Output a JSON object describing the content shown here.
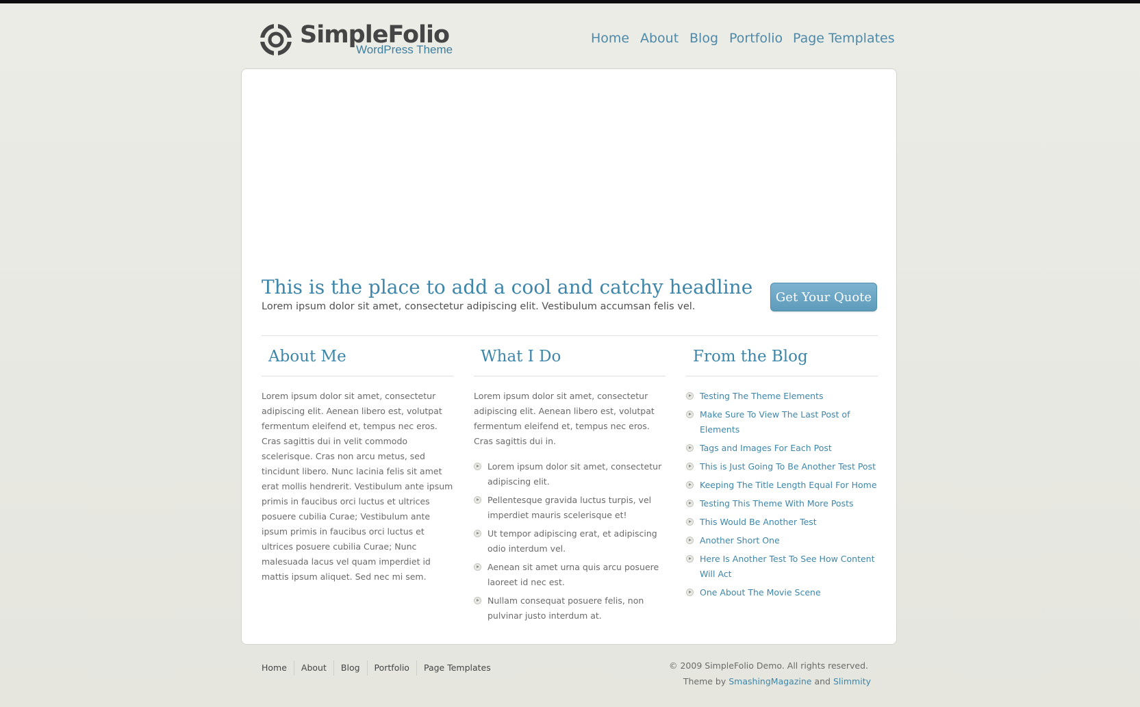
{
  "header": {
    "logo_title": "SimpleFolio",
    "logo_subtitle": "WordPress Theme",
    "nav": [
      "Home",
      "About",
      "Blog",
      "Portfolio",
      "Page Templates"
    ]
  },
  "hero": {
    "headline": "This is the place to add a cool and catchy headline",
    "subline": "Lorem ipsum dolor sit amet, consectetur adipiscing elit. Vestibulum accumsan felis vel.",
    "button_label": "Get Your Quote"
  },
  "about": {
    "title": "About Me",
    "text": "Lorem ipsum dolor sit amet, consectetur adipiscing elit. Aenean libero est, volutpat fermentum eleifend et, tempus nec eros. Cras sagittis dui in velit commodo scelerisque. Cras non arcu metus, sed tincidunt libero. Nunc lacinia felis sit amet erat mollis hendrerit. Vestibulum ante ipsum primis in faucibus orci luctus et ultrices posuere cubilia Curae; Vestibulum ante ipsum primis in faucibus orci luctus et ultrices posuere cubilia Curae; Nunc malesuada lacus vel quam imperdiet id mattis ipsum aliquet. Sed nec mi sem."
  },
  "whatido": {
    "title": "What I Do",
    "text": "Lorem ipsum dolor sit amet, consectetur adipiscing elit. Aenean libero est, volutpat fermentum eleifend et, tempus nec eros. Cras sagittis dui in.",
    "items": [
      "Lorem ipsum dolor sit amet, consectetur adipiscing elit.",
      "Pellentesque gravida luctus turpis, vel imperdiet mauris scelerisque et!",
      "Ut tempor adipiscing erat, et adipiscing odio interdum vel.",
      "Aenean sit amet urna quis arcu posuere laoreet id nec est.",
      "Nullam consequat posuere felis, non pulvinar justo interdum at."
    ]
  },
  "blog": {
    "title": "From the Blog",
    "posts": [
      "Testing The Theme Elements",
      "Make Sure To View The Last Post of Elements",
      "Tags and Images For Each Post",
      "This is Just Going To Be Another Test Post",
      "Keeping The Title Length Equal For Home",
      "Testing This Theme With More Posts",
      "This Would Be Another Test",
      "Another Short One",
      "Here Is Another Test To See How Content Will Act",
      "One About The Movie Scene"
    ]
  },
  "footer": {
    "nav": [
      "Home",
      "About",
      "Blog",
      "Portfolio",
      "Page Templates"
    ],
    "copyright": "© 2009 SimpleFolio Demo. All rights reserved.",
    "theme_by_prefix": "Theme by",
    "theme_by_link1": "SmashingMagazine",
    "theme_by_and": "and",
    "theme_by_link2": "Slimmity"
  },
  "colors": {
    "accent": "#3e86a9",
    "nav_link": "#4d89a8",
    "button": "#6aa5c4",
    "background": "#eaeae5",
    "topbar": "#0d0d0d"
  }
}
